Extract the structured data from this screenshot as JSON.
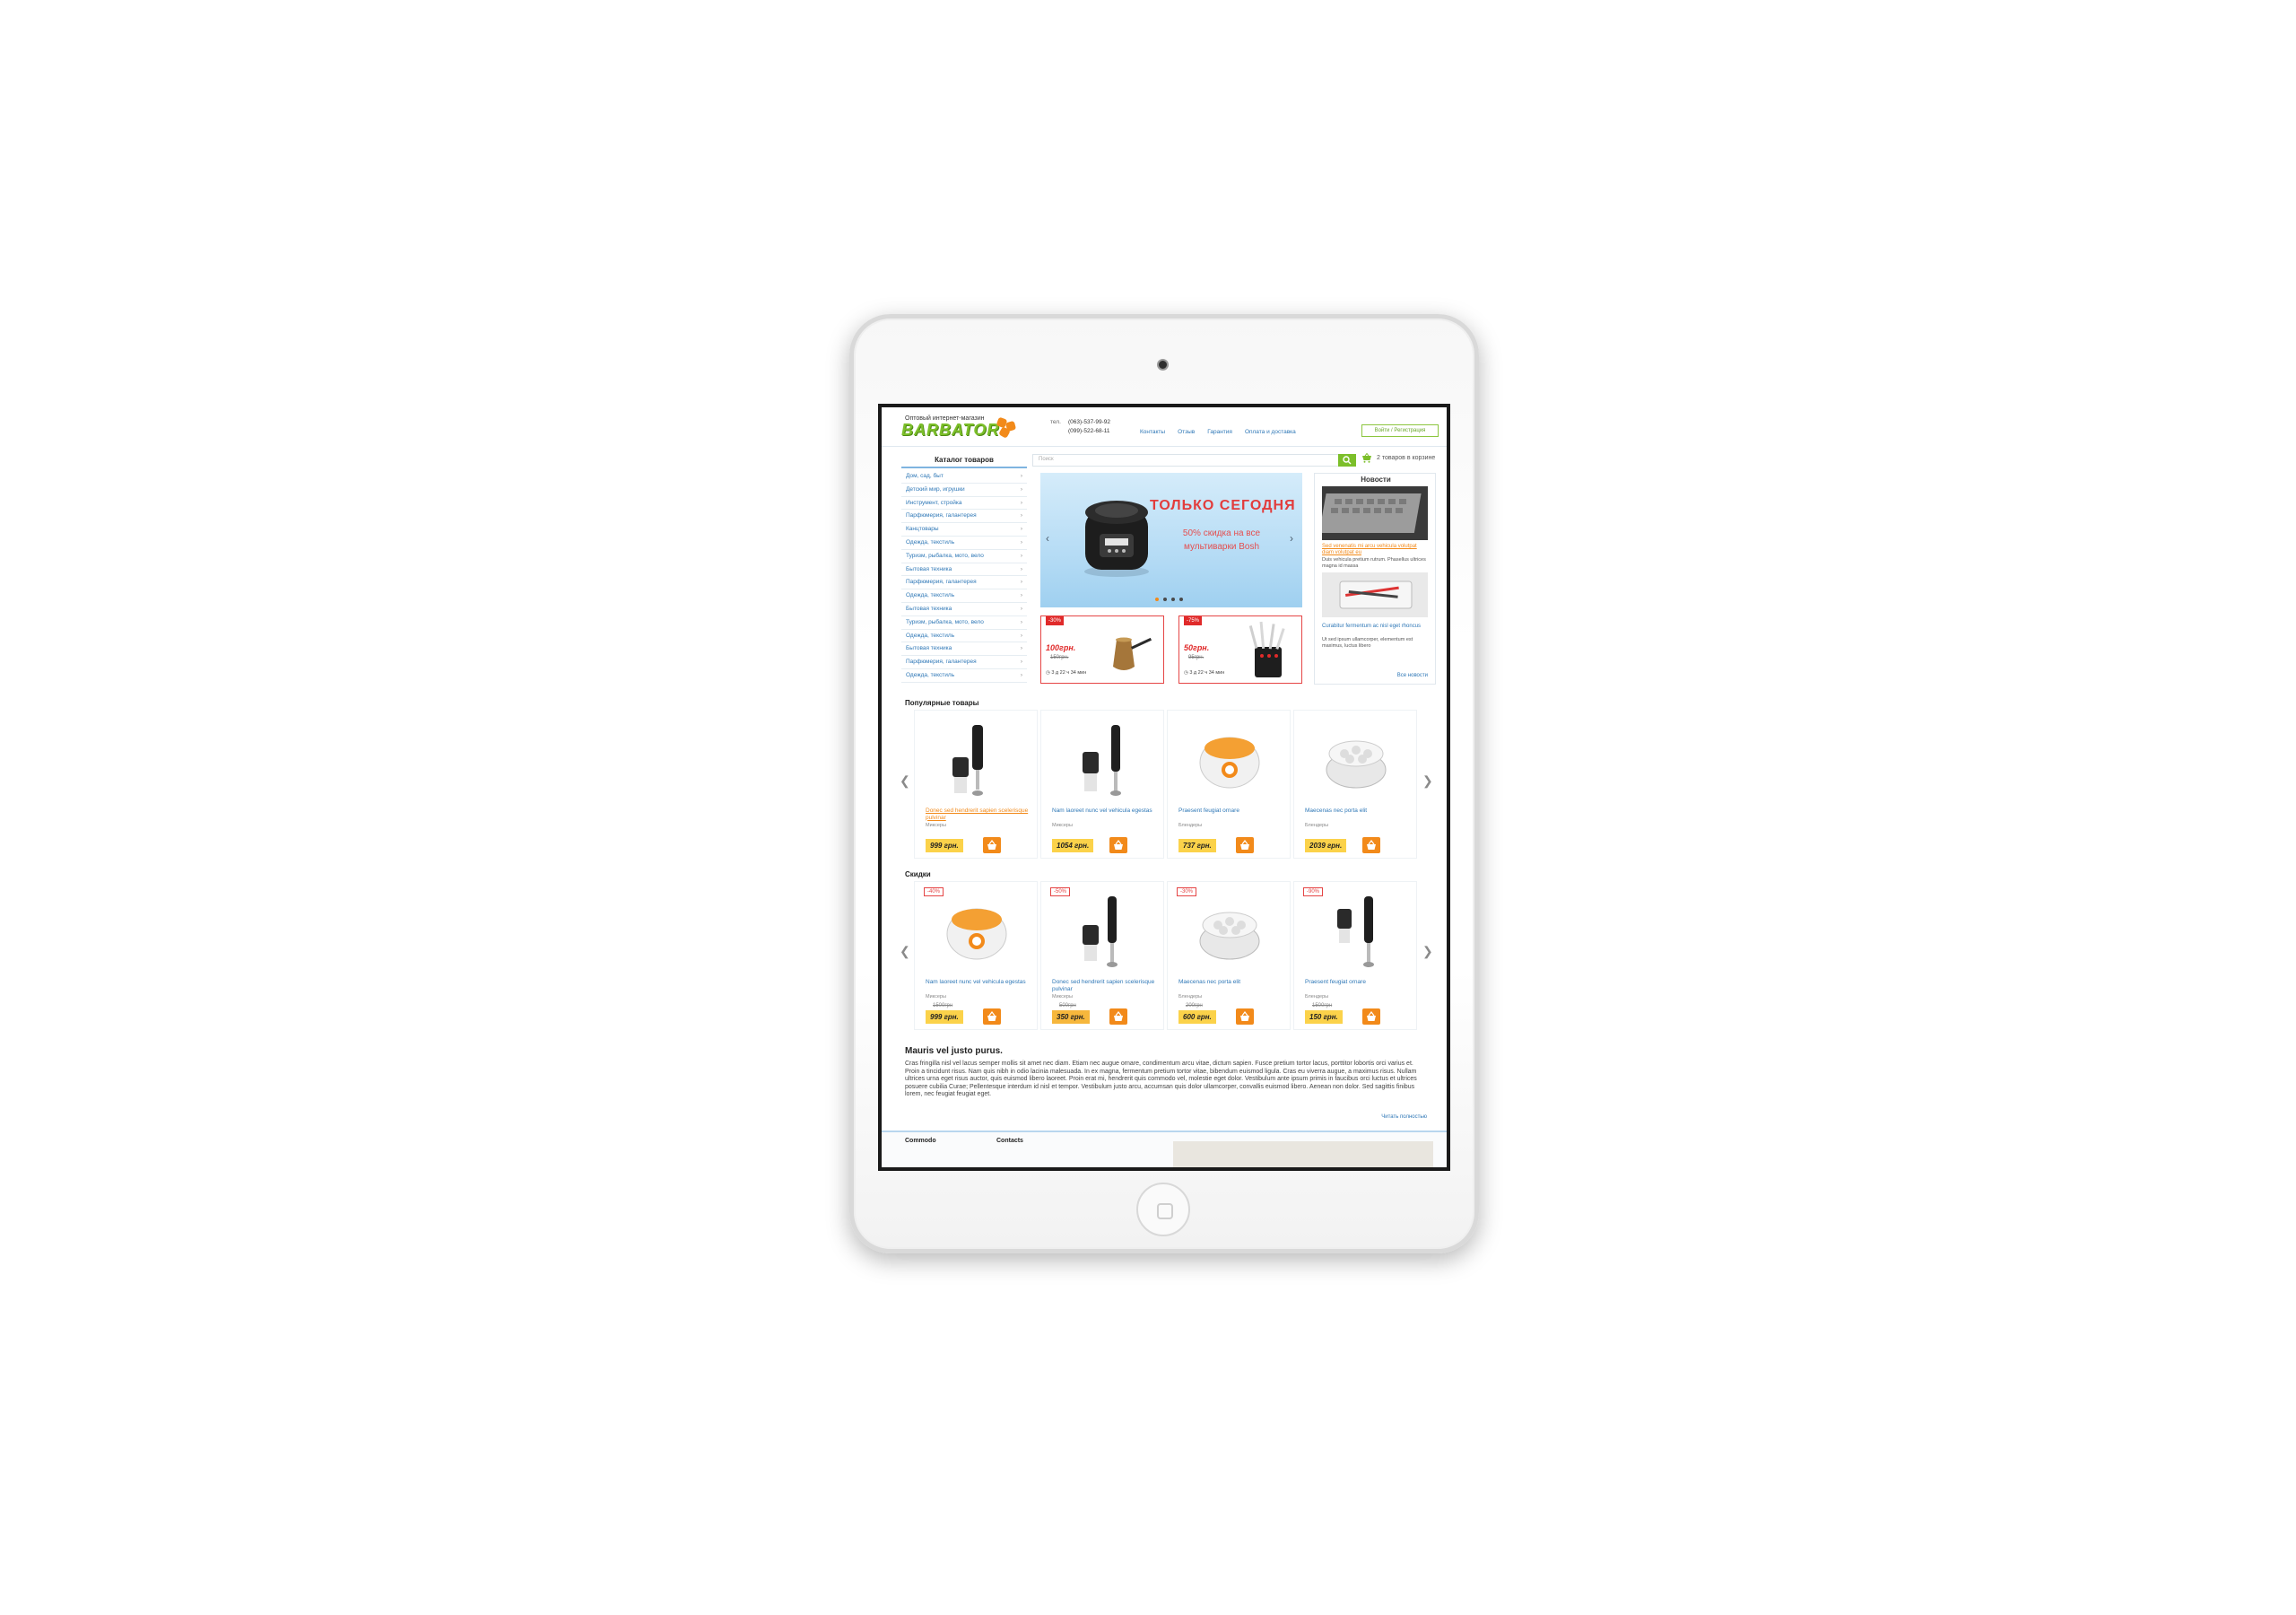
{
  "header": {
    "logo_tagline": "Оптовый интернет-магазин",
    "logo_text": "BARBATOR",
    "phone_label": "тел.",
    "phone_1": "(063)-537-99-92",
    "phone_2": "(099)-522-68-11",
    "nav": [
      "Контакты",
      "Отзыв",
      "Гарантия",
      "Оплата и доставка"
    ],
    "login_label": "Войти / Регистрация"
  },
  "catalog": {
    "title": "Каталог товаров",
    "items": [
      "Дом, сад, быт",
      "Детский мир, игрушки",
      "Инструмент, стройка",
      "Парфюмерия, галантерея",
      "Канцтовары",
      "Одежда, текстиль",
      "Туризм, рыбалка, мото, вело",
      "Бытовая техника",
      "Парфюмерия, галантерея",
      "Одежда, текстиль",
      "Бытовая техника",
      "Туризм, рыбалка, мото, вело",
      "Одежда, текстиль",
      "Бытовая техника",
      "Парфюмерия, галантерея",
      "Одежда, текстиль"
    ]
  },
  "search": {
    "placeholder": "Поиск",
    "cart_text": "2 товаров в корзине"
  },
  "banner": {
    "title": "ТОЛЬКО СЕГОДНЯ",
    "subtitle": "50% скидка на все мультиварки Bosh",
    "slide_count": 4,
    "active_slide": 1
  },
  "promos": [
    {
      "badge": "-30%",
      "price": "100грн.",
      "old_price": "150грн.",
      "timer": "3 д 22 ч 34 мин"
    },
    {
      "badge": "-75%",
      "price": "50грн.",
      "old_price": "95грн.",
      "timer": "3 д 22 ч 34 мин"
    }
  ],
  "news": {
    "title": "Новости",
    "items": [
      {
        "link": "Sed venenatis mi arcu vehicula volutpat diam volutpat eu",
        "text": "Duis vehicula pretium rutrum. Phasellus ultrices magna id massa"
      },
      {
        "link": "Curabitur fermentum ac nisl eget rhoncus",
        "text": "Ut sed ipsum ullamcorper, elementum est maximus, luctus libero"
      }
    ],
    "all_link": "Все новости"
  },
  "popular": {
    "title": "Популярные товары",
    "products": [
      {
        "name": "Donec sed hendrerit sapien scelerisque pulvinar",
        "category": "Миксеры",
        "price": "999 грн.",
        "hot": true,
        "icon": "blender-icon"
      },
      {
        "name": "Nam laoreet nunc vel vehicula egestas",
        "category": "Миксеры",
        "price": "1054 грн.",
        "hot": false,
        "icon": "blender-icon"
      },
      {
        "name": "Praesent feugiat ornare",
        "category": "Блендеры",
        "price": "737 грн.",
        "hot": false,
        "icon": "yogurt-maker-icon"
      },
      {
        "name": "Maecenas nec porta elit",
        "category": "Блендеры",
        "price": "2039 грн.",
        "hot": false,
        "icon": "yogurt-maker-icon"
      }
    ]
  },
  "discounts": {
    "title": "Скидки",
    "products": [
      {
        "badge": "-40%",
        "name": "Nam laoreet nunc vel vehicula egestas",
        "category": "Миксеры",
        "old_price": "1500грн",
        "price": "999 грн.",
        "icon": "yogurt-maker-icon"
      },
      {
        "badge": "-50%",
        "name": "Donec sed hendrerit sapien scelerisque pulvinar",
        "category": "Миксеры",
        "old_price": "500грн",
        "price": "350 грн.",
        "icon": "blender-icon"
      },
      {
        "badge": "-30%",
        "name": "Maecenas nec porta elit",
        "category": "Блендеры",
        "old_price": "200грн",
        "price": "600 грн.",
        "icon": "yogurt-maker-icon"
      },
      {
        "badge": "-90%",
        "name": "Praesent feugiat ornare",
        "category": "Блендеры",
        "old_price": "1500грн",
        "price": "150 грн.",
        "icon": "blender-icon"
      }
    ]
  },
  "seo": {
    "title": "Mauris vel justo purus.",
    "text": "Cras fringilla nisl vel lacus semper mollis sit amet nec diam. Etiam nec augue ornare, condimentum arcu vitae, dictum sapien. Fusce pretium tortor lacus, porttitor lobortis orci varius et. Proin a tincidunt risus. Nam quis nibh in odio lacinia malesuada. In ex magna, fermentum pretium tortor vitae, bibendum euismod ligula. Cras eu viverra augue, a maximus risus. Nullam ultrices urna eget risus auctor, quis euismod libero laoreet. Proin erat mi, hendrerit quis commodo vel, molestie eget dolor. Vestibulum ante ipsum primis in faucibus orci luctus et ultrices posuere cubilia Curae; Pellentesque interdum id nisl et tempor. Vestibulum justo arcu, accumsan quis dolor ullamcorper, convallis euismod libero. Aenean non dolor. Sed sagittis finibus lorem, nec feugiat feugiat eget.",
    "more_link": "Читать полностью"
  },
  "footer": {
    "col1": "Commodo",
    "col2": "Contacts"
  },
  "colors": {
    "accent_green": "#7cbf2a",
    "accent_orange": "#f28a1a",
    "link_blue": "#2f78b7",
    "sale_red": "#e02a2a",
    "price_yellow": "#fbd24a"
  }
}
